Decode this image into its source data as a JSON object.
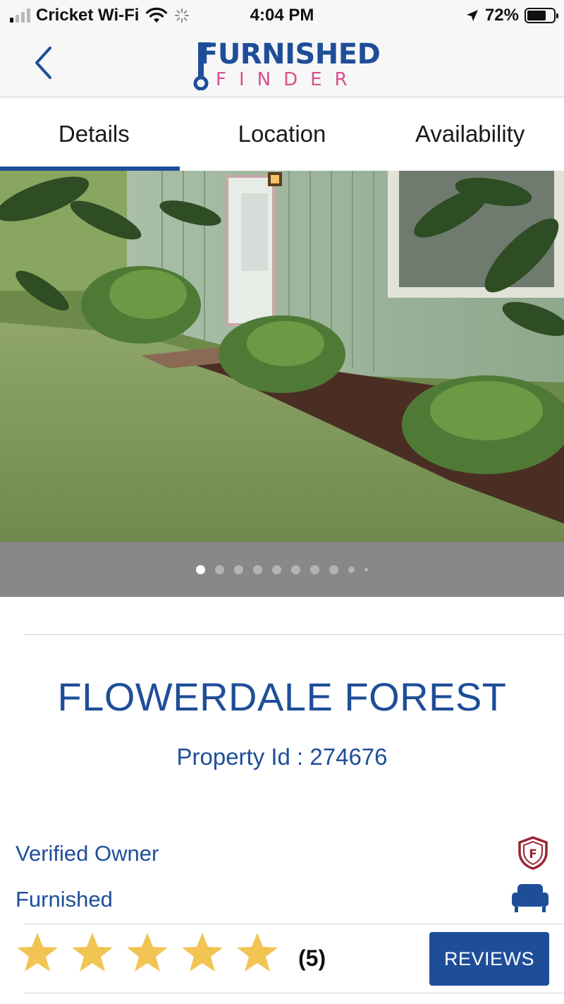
{
  "status_bar": {
    "carrier": "Cricket Wi-Fi",
    "time": "4:04 PM",
    "battery_percent": "72%",
    "battery_level": 0.72,
    "signal_bars_active": 1,
    "signal_bars_total": 4
  },
  "nav": {
    "back_icon": "chevron-left-icon",
    "logo_top": "FURNISHED",
    "logo_bottom": "FINDER"
  },
  "tabs": [
    {
      "label": "Details",
      "active": true
    },
    {
      "label": "Location",
      "active": false
    },
    {
      "label": "Availability",
      "active": false
    }
  ],
  "gallery": {
    "total_dots": 10,
    "active_index": 0
  },
  "property": {
    "title": "FLOWERDALE FOREST",
    "id_text": "Property Id : 274676"
  },
  "features": [
    {
      "label": "Verified Owner",
      "icon": "shield-verified-icon"
    },
    {
      "label": "Furnished",
      "icon": "sofa-icon"
    }
  ],
  "rating": {
    "stars": 5,
    "max_stars": 5,
    "count_text": "(5)",
    "reviews_button": "REVIEWS"
  },
  "colors": {
    "brand_blue": "#1f4e99",
    "brand_pink": "#d94f8c",
    "star_gold": "#f1c453",
    "pager_bg": "#888888"
  }
}
